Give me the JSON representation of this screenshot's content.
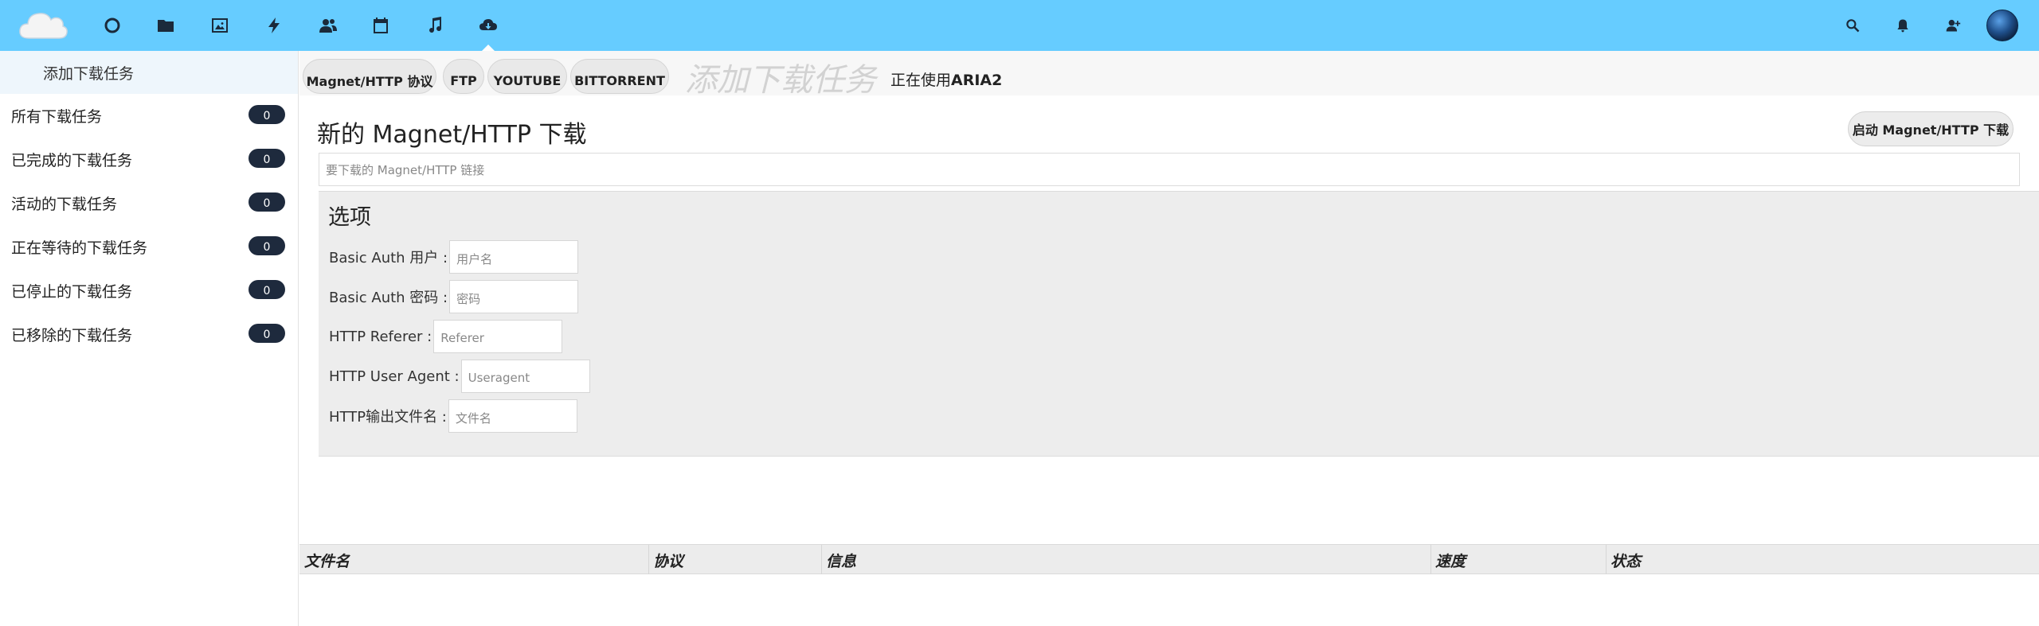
{
  "header": {
    "apps": [
      {
        "icon": "circle-icon"
      },
      {
        "icon": "folder-icon"
      },
      {
        "icon": "image-icon"
      },
      {
        "icon": "lightning-icon"
      },
      {
        "icon": "contacts-icon"
      },
      {
        "icon": "calendar-icon"
      },
      {
        "icon": "music-icon"
      },
      {
        "icon": "cloud-download-icon",
        "active": true
      }
    ],
    "right_icons": [
      "search-icon",
      "bell-icon",
      "user-add-icon"
    ],
    "colors": {
      "bar": "#66ccff",
      "icons": "#1b2a3b"
    }
  },
  "sidebar": {
    "new_task": "添加下载任务",
    "items": [
      {
        "label": "所有下载任务",
        "count": "0"
      },
      {
        "label": "已完成的下载任务",
        "count": "0"
      },
      {
        "label": "活动的下载任务",
        "count": "0"
      },
      {
        "label": "正在等待的下载任务",
        "count": "0"
      },
      {
        "label": "已停止的下载任务",
        "count": "0"
      },
      {
        "label": "已移除的下载任务",
        "count": "0"
      }
    ]
  },
  "tabs": {
    "items": [
      "Magnet/HTTP 协议",
      "FTP",
      "YOUTUBE",
      "BITTORRENT"
    ],
    "title": "添加下载任务",
    "engine_prefix": "正在使用",
    "engine_name": "ARIA2"
  },
  "form": {
    "title": "新的 Magnet/HTTP 下载",
    "start_button": "启动 Magnet/HTTP 下载",
    "url_placeholder": "要下载的 Magnet/HTTP 链接",
    "options_title": "选项",
    "options": [
      {
        "label": "Basic Auth 用户 :",
        "placeholder": "用户名"
      },
      {
        "label": "Basic Auth 密码 :",
        "placeholder": "密码"
      },
      {
        "label": "HTTP Referer :",
        "placeholder": "Referer"
      },
      {
        "label": "HTTP User Agent :",
        "placeholder": "Useragent"
      },
      {
        "label": "HTTP输出文件名 :",
        "placeholder": "文件名"
      }
    ]
  },
  "table": {
    "columns": [
      "文件名",
      "协议",
      "信息",
      "速度",
      "状态"
    ]
  }
}
